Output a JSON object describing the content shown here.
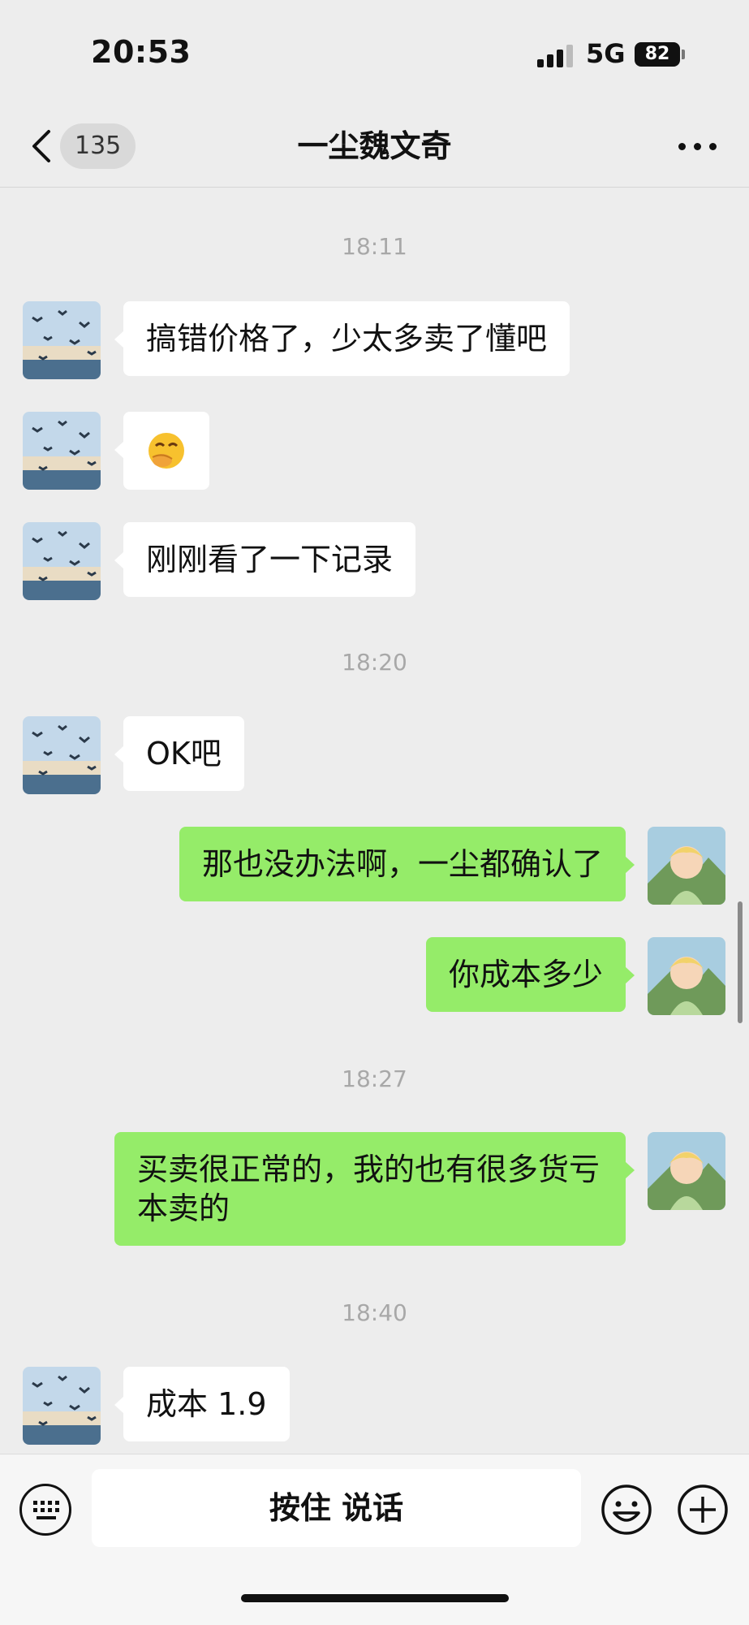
{
  "status_bar": {
    "time": "20:53",
    "network": "5G",
    "battery": "82"
  },
  "header": {
    "back_count": "135",
    "title": "一尘魏文奇"
  },
  "messages": [
    {
      "type": "time",
      "text": "18:11"
    },
    {
      "type": "text",
      "side": "left",
      "text": "搞错价格了，少太多卖了懂吧"
    },
    {
      "type": "emoji",
      "side": "left",
      "icon": "face-with-hand-over-mouth-emoji"
    },
    {
      "type": "text",
      "side": "left",
      "text": "刚刚看了一下记录"
    },
    {
      "type": "time",
      "text": "18:20"
    },
    {
      "type": "text",
      "side": "left",
      "text": "OK吧"
    },
    {
      "type": "text",
      "side": "right",
      "text": "那也没办法啊，一尘都确认了"
    },
    {
      "type": "text",
      "side": "right",
      "text": "你成本多少"
    },
    {
      "type": "time",
      "text": "18:27"
    },
    {
      "type": "text",
      "side": "right",
      "text": "买卖很正常的，我的也有很多货亏本卖的"
    },
    {
      "type": "time",
      "text": "18:40"
    },
    {
      "type": "text",
      "side": "left",
      "text": "成本 1.9"
    }
  ],
  "input_bar": {
    "hold_to_talk_label": "按住 说话"
  },
  "colors": {
    "background": "#ededed",
    "sent_bubble": "#95ec69",
    "received_bubble": "#ffffff"
  }
}
